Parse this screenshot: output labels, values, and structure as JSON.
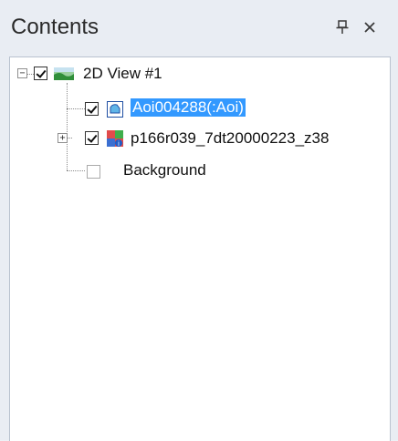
{
  "panel": {
    "title": "Contents",
    "pin_glyph": "q",
    "close_glyph": "✕",
    "icons": {
      "pin": "pin-icon",
      "close": "close-icon"
    }
  },
  "tree": {
    "root": {
      "label": "2D View #1",
      "expanded": true,
      "checked": true,
      "icon": "map-view-icon"
    },
    "items": [
      {
        "label": "Aoi004288(:Aoi)",
        "checked": true,
        "selected": true,
        "icon": "aoi-layer-icon",
        "expandable": false
      },
      {
        "label": "p166r039_7dt20000223_z38",
        "checked": true,
        "selected": false,
        "icon": "raster-layer-icon",
        "expandable": true,
        "expanded": false
      },
      {
        "label": "Background",
        "checked": false,
        "selected": false,
        "icon": "none",
        "expandable": false
      }
    ]
  },
  "colors": {
    "selection": "#3399ff",
    "panel_bg": "#e9edf3",
    "tree_bg": "#ffffff"
  }
}
